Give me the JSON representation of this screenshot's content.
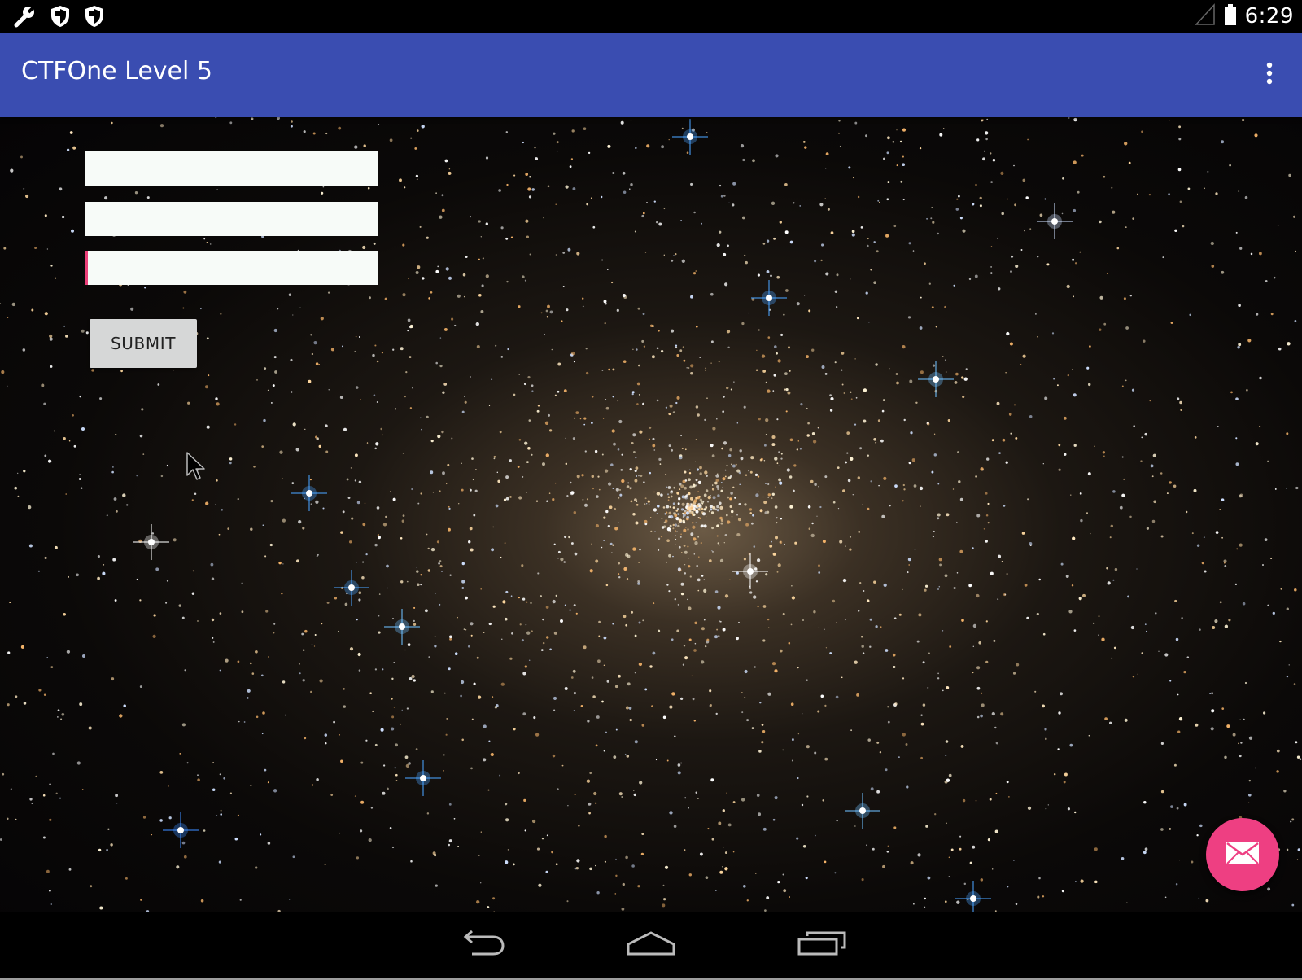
{
  "status_bar": {
    "time": "6:29",
    "left_icons": [
      "wrench-icon",
      "shield-icon",
      "shield-icon"
    ],
    "right_icons": [
      "signal-icon",
      "battery-icon"
    ]
  },
  "app_bar": {
    "title": "CTFOne Level 5",
    "menu_icon": "overflow-menu-icon",
    "color": "#3a4db1"
  },
  "form": {
    "fields": [
      {
        "value": "",
        "placeholder": "",
        "focused": false
      },
      {
        "value": "",
        "placeholder": "",
        "focused": false
      },
      {
        "value": "",
        "placeholder": "",
        "focused": true
      }
    ],
    "submit_label": "SUBMIT"
  },
  "fab": {
    "icon": "envelope-icon",
    "color": "#ee3f82"
  },
  "nav_bar": {
    "buttons": [
      "back-icon",
      "home-icon",
      "recents-icon"
    ]
  },
  "accent_color": "#ec407a"
}
